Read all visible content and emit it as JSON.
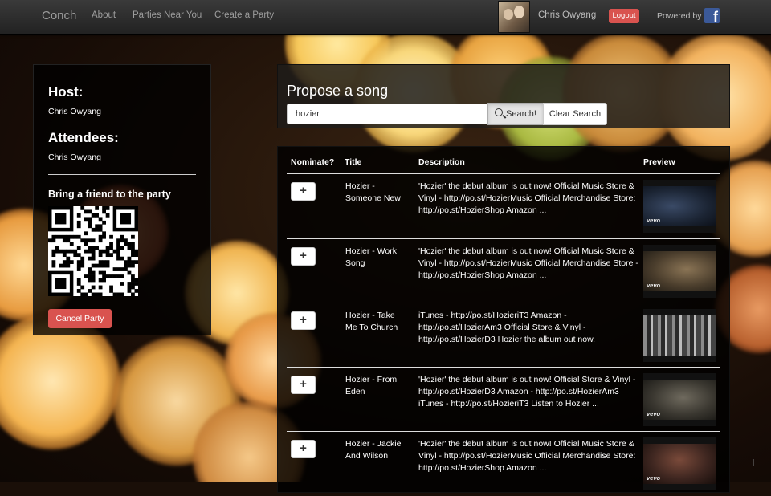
{
  "navbar": {
    "brand": "Conch",
    "links": [
      "About",
      "Parties Near You",
      "Create a Party"
    ],
    "user_name": "Chris Owyang",
    "logout_label": "Logout",
    "powered_by": "Powered by"
  },
  "sidebar": {
    "host_heading": "Host:",
    "host_name": "Chris Owyang",
    "attendees_heading": "Attendees:",
    "attendees": [
      "Chris Owyang"
    ],
    "invite_heading": "Bring a friend to the party",
    "cancel_label": "Cancel Party"
  },
  "search": {
    "heading": "Propose a song",
    "value": "hozier",
    "search_label": "Search!",
    "clear_label": "Clear Search"
  },
  "results": {
    "columns": [
      "Nominate?",
      "Title",
      "Description",
      "Preview"
    ],
    "nominate_label": "+",
    "rows": [
      {
        "title": "Hozier - Someone New",
        "description": "'Hozier' the debut album is out now! Official Music Store & Vinyl - http://po.st/HozierMusic Official Merchandise Store: http://po.st/HozierShop Amazon ...",
        "thumb_label": "vevo"
      },
      {
        "title": "Hozier - Work Song",
        "description": "'Hozier' the debut album is out now! Official Music Store & Vinyl - http://po.st/HozierMusic Official Merchandise Store - http://po.st/HozierShop Amazon ...",
        "thumb_label": "vevo"
      },
      {
        "title": "Hozier - Take Me To Church",
        "description": "iTunes - http://po.st/HozieriT3 Amazon - http://po.st/HozierAm3 Official Store & Vinyl - http://po.st/HozierD3 Hozier the album out now.",
        "thumb_label": ""
      },
      {
        "title": "Hozier - From Eden",
        "description": "'Hozier' the debut album is out now! Official Store & Vinyl - http://po.st/HozierD3 Amazon - http://po.st/HozierAm3 iTunes - http://po.st/HozieriT3 Listen to Hozier ...",
        "thumb_label": "vevo"
      },
      {
        "title": "Hozier - Jackie And Wilson",
        "description": "'Hozier' the debut album is out now! Official Music Store & Vinyl - http://po.st/HozierMusic Official Merchandise Store: http://po.st/HozierShop Amazon ...",
        "thumb_label": "vevo"
      }
    ]
  },
  "colors": {
    "danger": "#d9534f",
    "facebook": "#3b5998",
    "navbar": "#222222"
  },
  "icons": [
    "facebook-icon",
    "search-icon",
    "plus-icon",
    "resize-icon"
  ]
}
